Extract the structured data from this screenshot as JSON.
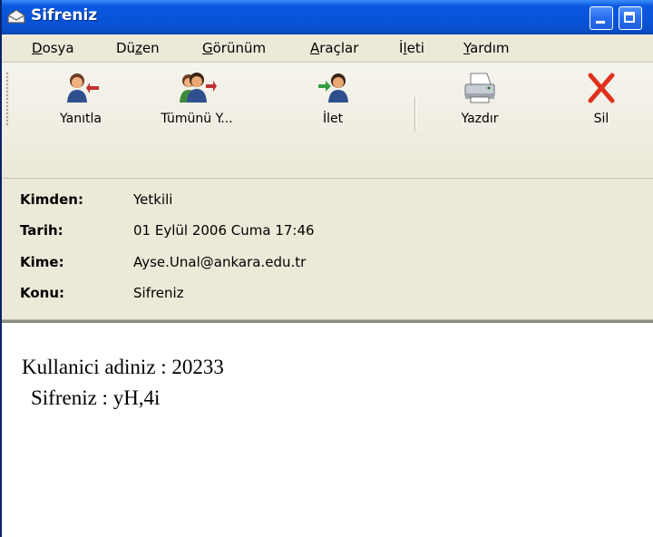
{
  "window": {
    "title": "Sifreniz"
  },
  "menu": {
    "items": [
      {
        "accel": "D",
        "rest": "osya"
      },
      {
        "pre": "Dü",
        "accel": "z",
        "rest": "en"
      },
      {
        "accel": "G",
        "rest": "örünüm"
      },
      {
        "accel": "A",
        "rest": "raçlar"
      },
      {
        "pre": "İ",
        "accel": "l",
        "rest": "eti"
      },
      {
        "accel": "Y",
        "rest": "ardım"
      }
    ]
  },
  "toolbar": {
    "reply_label": "Yanıtla",
    "reply_all_label": "Tümünü Y...",
    "forward_label": "İlet",
    "print_label": "Yazdır",
    "delete_label": "Sil"
  },
  "header": {
    "from_label": "Kimden:",
    "from_value": "Yetkili",
    "date_label": "Tarih:",
    "date_value": "01 Eylül 2006 Cuma 17:46",
    "to_label": "Kime:",
    "to_value": "Ayse.Unal@ankara.edu.tr",
    "subject_label": "Konu:",
    "subject_value": "Sifreniz"
  },
  "body": {
    "line1": "Kullanici adiniz : 20233",
    "line2": "Sifreniz : yH,4i"
  },
  "colors": {
    "titlebar": "#0853d8",
    "chrome": "#ece9d8",
    "delete_x": "#e0301e"
  }
}
